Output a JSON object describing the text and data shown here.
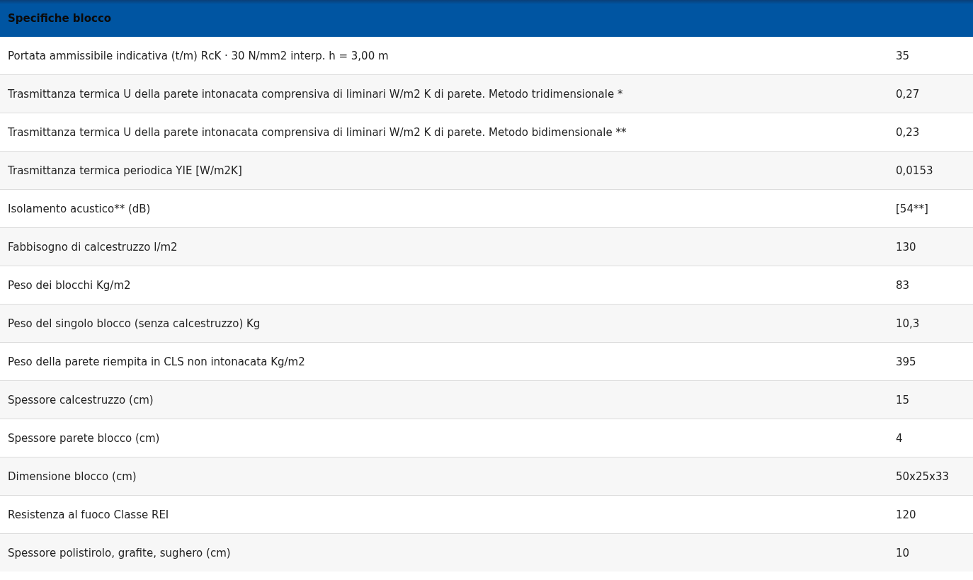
{
  "table": {
    "title": "Specifiche blocco",
    "rows": [
      {
        "label": "Portata ammissibile indicativa (t/m) RcK · 30 N/mm2 interp. h = 3,00 m",
        "value": "35"
      },
      {
        "label": "Trasmittanza termica U della parete intonacata comprensiva di liminari W/m2 K di parete. Metodo tridimensionale *",
        "value": "0,27"
      },
      {
        "label": "Trasmittanza termica U della parete intonacata comprensiva di liminari W/m2 K di parete. Metodo bidimensionale **",
        "value": "0,23"
      },
      {
        "label": "Trasmittanza termica periodica YIE [W/m2K]",
        "value": "0,0153"
      },
      {
        "label": "Isolamento acustico** (dB)",
        "value": "[54**]"
      },
      {
        "label": "Fabbisogno di calcestruzzo l/m2",
        "value": "130"
      },
      {
        "label": "Peso dei blocchi Kg/m2",
        "value": "83"
      },
      {
        "label": "Peso del singolo blocco (senza calcestruzzo) Kg",
        "value": "10,3"
      },
      {
        "label": "Peso della parete riempita in CLS non intonacata Kg/m2",
        "value": "395"
      },
      {
        "label": "Spessore calcestruzzo (cm)",
        "value": "15"
      },
      {
        "label": "Spessore parete blocco (cm)",
        "value": "4"
      },
      {
        "label": "Dimensione blocco (cm)",
        "value": "50x25x33"
      },
      {
        "label": "Resistenza al fuoco Classe REI",
        "value": "120"
      },
      {
        "label": "Spessore polistirolo, grafite, sughero (cm)",
        "value": "10"
      }
    ]
  }
}
